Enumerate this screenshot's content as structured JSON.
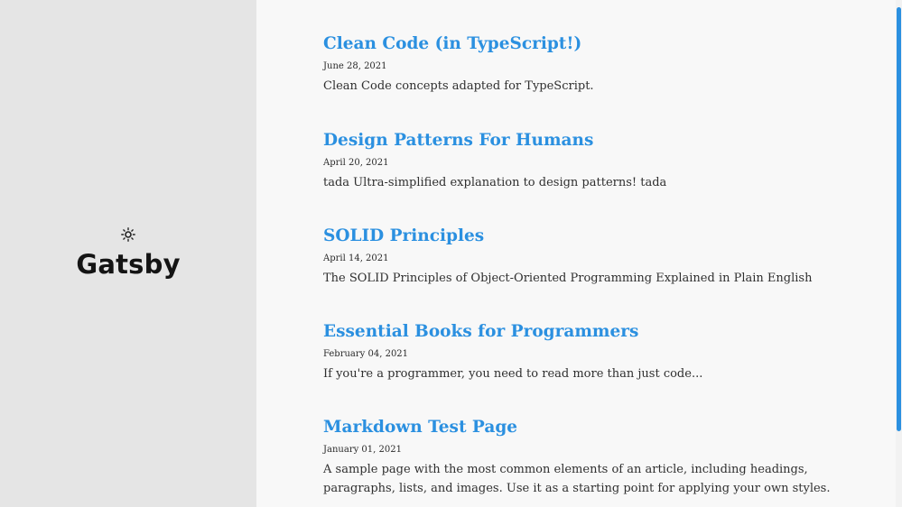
{
  "sidebar": {
    "theme_icon": "sun-icon",
    "site_title": "Gatsby"
  },
  "posts": [
    {
      "title": "Clean Code (in TypeScript!)",
      "date": "June 28, 2021",
      "description": "Clean Code concepts adapted for TypeScript."
    },
    {
      "title": "Design Patterns For Humans",
      "date": "April 20, 2021",
      "description": "tada Ultra-simplified explanation to design patterns! tada"
    },
    {
      "title": "SOLID Principles",
      "date": "April 14, 2021",
      "description": "The SOLID Principles of Object-Oriented Programming Explained in Plain English"
    },
    {
      "title": "Essential Books for Programmers",
      "date": "February 04, 2021",
      "description": "If you're a programmer, you need to read more than just code..."
    },
    {
      "title": "Markdown Test Page",
      "date": "January 01, 2021",
      "description": "A sample page with the most common elements of an article, including headings, paragraphs, lists, and images. Use it as a starting point for applying your own styles."
    }
  ],
  "colors": {
    "accent": "#2b90e0",
    "sidebar_bg": "#e5e5e5",
    "main_bg": "#f8f8f8"
  }
}
